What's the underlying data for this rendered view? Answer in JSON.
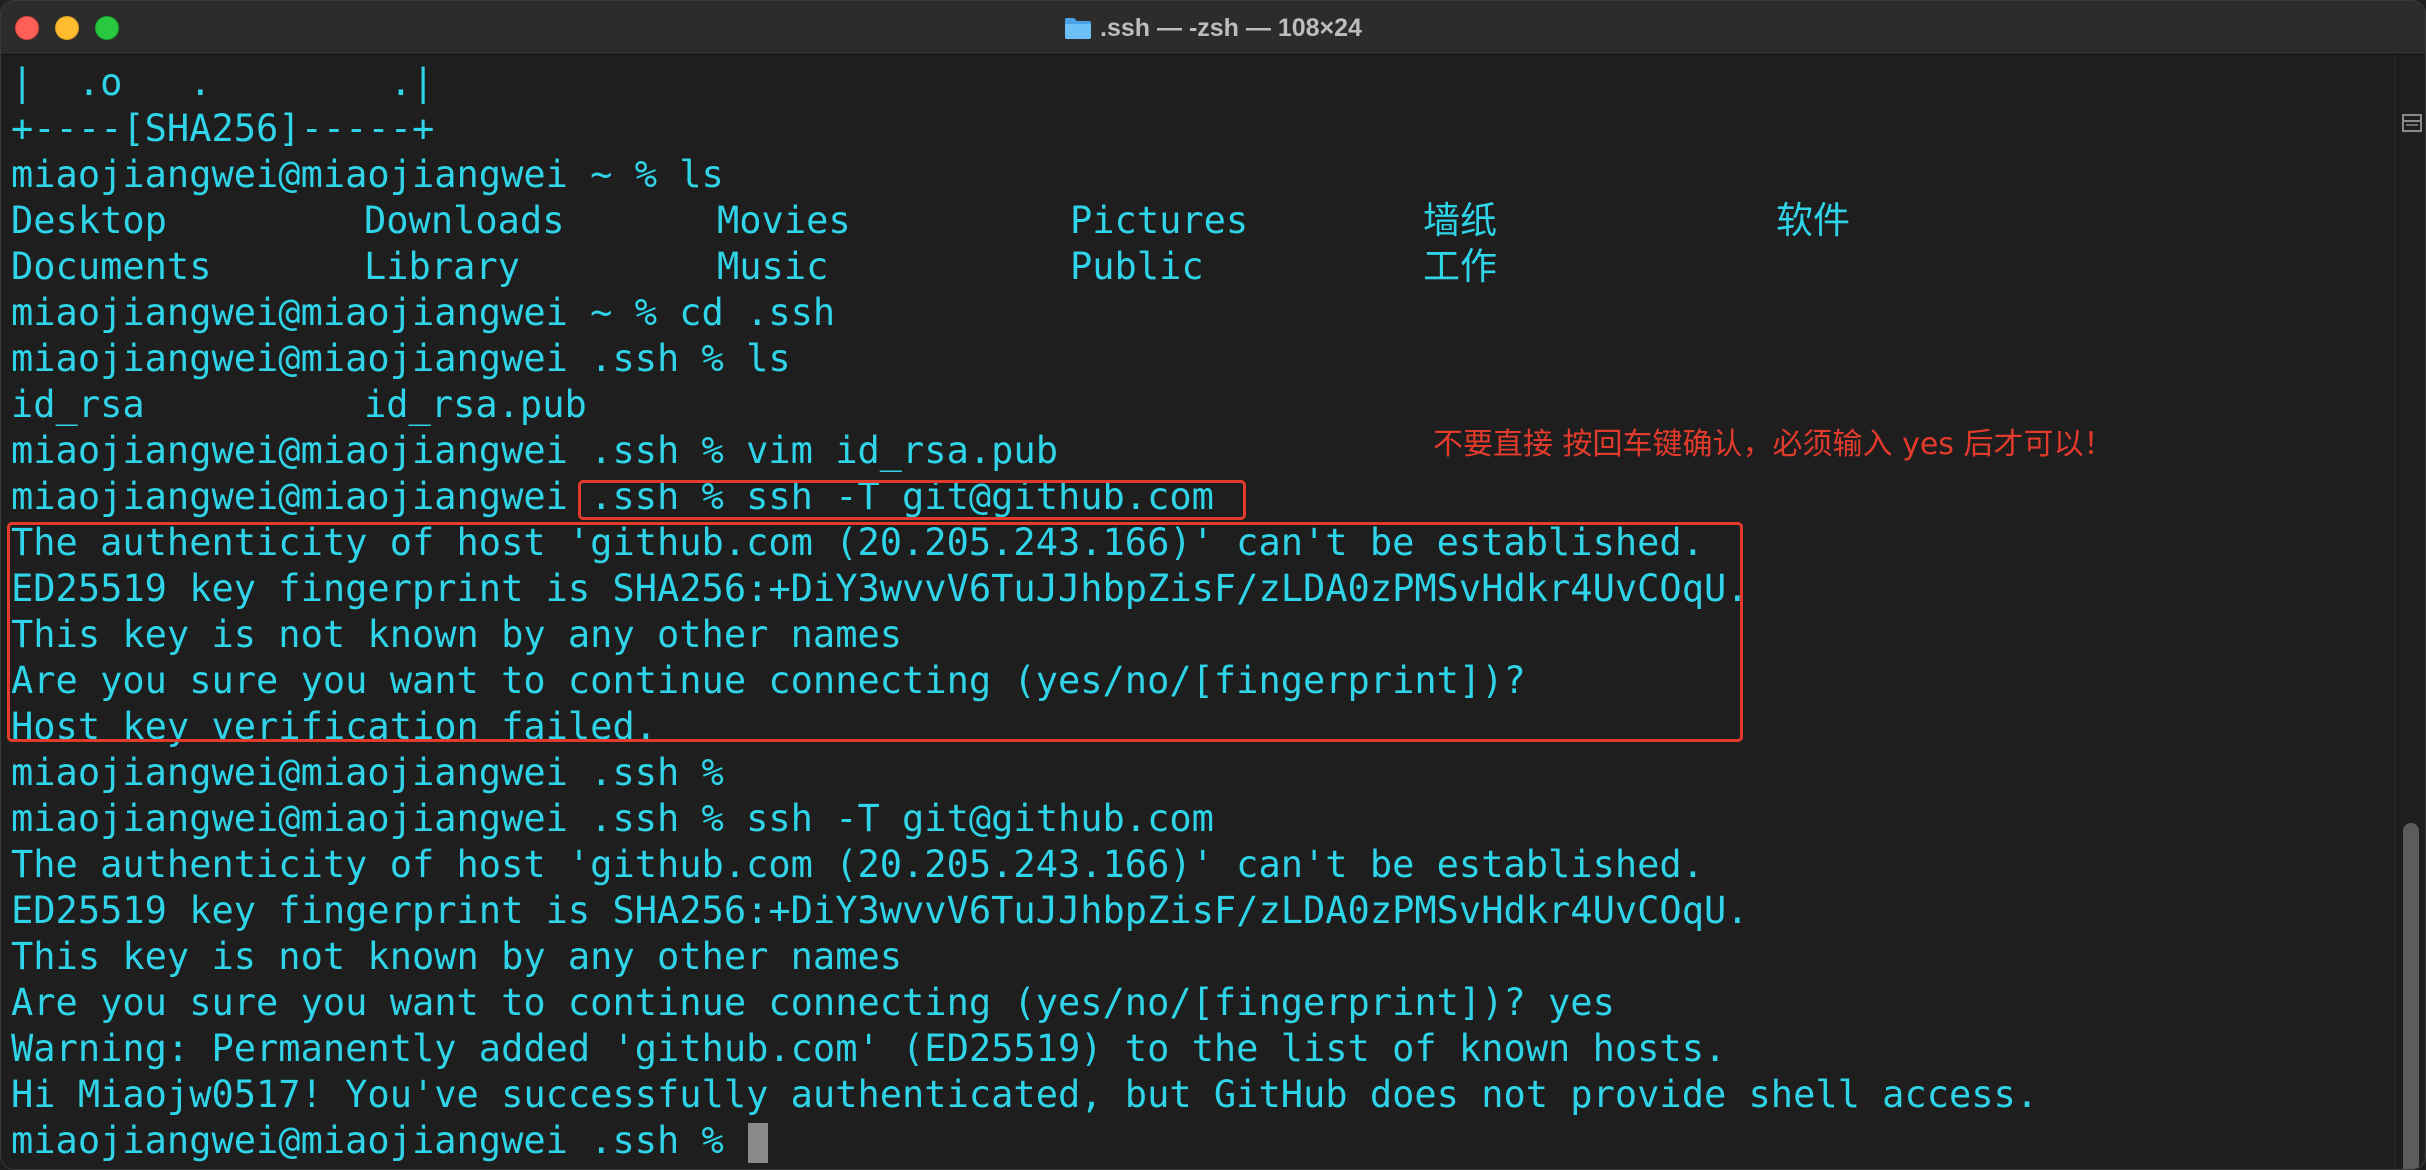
{
  "window": {
    "title": ".ssh — -zsh — 108×24",
    "folder_icon": "folder-icon"
  },
  "terminal": {
    "text_color": "#2fd4e8",
    "lines": [
      "|  .o   .        .|",
      "+----[SHA256]-----+",
      "miaojiangwei@miaojiangwei ~ % ls",
      "",
      "",
      "miaojiangwei@miaojiangwei ~ % cd .ssh",
      "miaojiangwei@miaojiangwei .ssh % ls",
      "",
      "miaojiangwei@miaojiangwei .ssh % vim id_rsa.pub",
      "miaojiangwei@miaojiangwei .ssh % ssh -T git@github.com",
      "The authenticity of host 'github.com (20.205.243.166)' can't be established.",
      "ED25519 key fingerprint is SHA256:+DiY3wvvV6TuJJhbpZisF/zLDA0zPMSvHdkr4UvCOqU.",
      "This key is not known by any other names",
      "Are you sure you want to continue connecting (yes/no/[fingerprint])?",
      "Host key verification failed.",
      "miaojiangwei@miaojiangwei .ssh %",
      "miaojiangwei@miaojiangwei .ssh % ssh -T git@github.com",
      "The authenticity of host 'github.com (20.205.243.166)' can't be established.",
      "ED25519 key fingerprint is SHA256:+DiY3wvvV6TuJJhbpZisF/zLDA0zPMSvHdkr4UvCOqU.",
      "This key is not known by any other names",
      "Are you sure you want to continue connecting (yes/no/[fingerprint])? yes",
      "Warning: Permanently added 'github.com' (ED25519) to the list of known hosts.",
      "Hi Miaojw0517! You've successfully authenticated, but GitHub does not provide shell access.",
      "miaojiangwei@miaojiangwei .ssh % "
    ],
    "ls_home_row1": [
      "Desktop",
      "Downloads",
      "Movies",
      "Pictures",
      "墙纸",
      "软件"
    ],
    "ls_home_row2": [
      "Documents",
      "Library",
      "Music",
      "Public",
      "工作"
    ],
    "ls_ssh_row": [
      "id_rsa",
      "id_rsa.pub"
    ]
  },
  "annotation": {
    "text": "不要直接 按回车键确认，必须输入 yes 后才可以！",
    "color": "#e23b2c"
  }
}
